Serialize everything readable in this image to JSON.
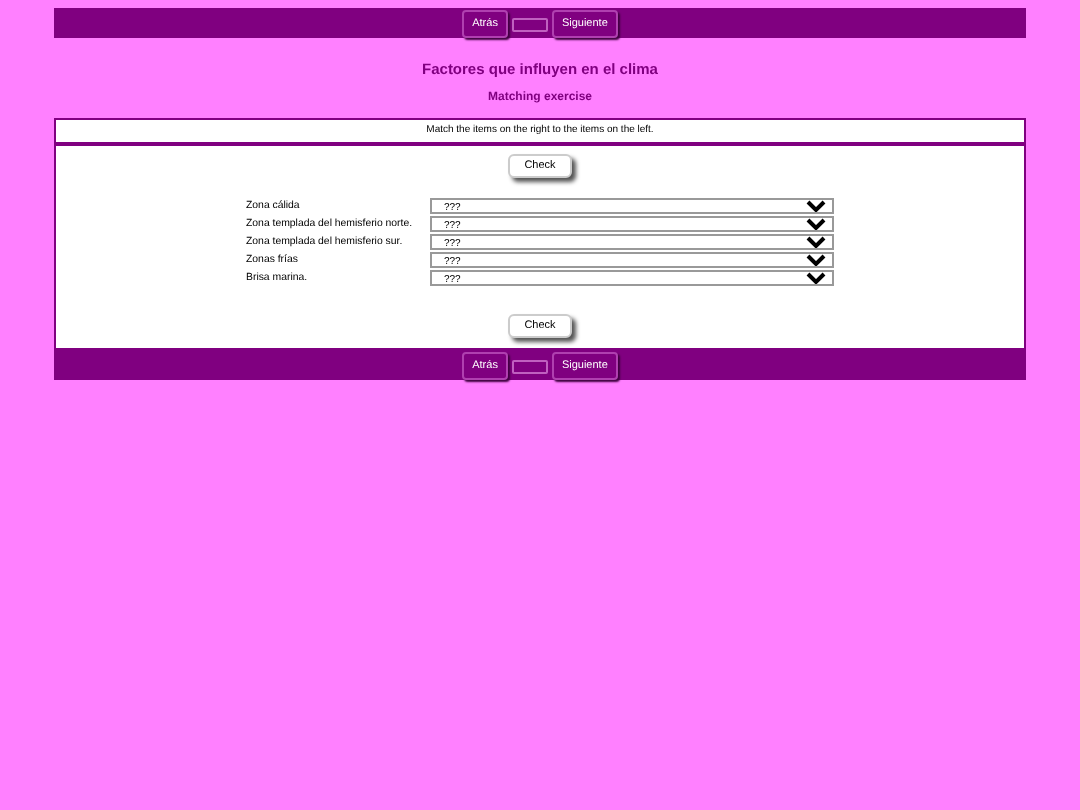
{
  "top_nav": {
    "prev": "Atrás",
    "next": "Siguiente"
  },
  "title": "Factores que influyen en el clima",
  "subtitle": "Matching exercise",
  "instructions": "Match the items on the right to the items on the left.",
  "check_buttons": [
    "Check",
    "Check"
  ],
  "items": [
    {
      "label": "Zona cálida",
      "value": "???"
    },
    {
      "label": "Zona templada del hemisferio norte.",
      "value": "???"
    },
    {
      "label": "Zona templada del hemisferio sur.",
      "value": "???"
    },
    {
      "label": "Zonas frías",
      "value": "???"
    },
    {
      "label": "Brisa marina.",
      "value": "???"
    }
  ],
  "bottom_nav": {
    "prev": "Atrás",
    "next": "Siguiente"
  }
}
